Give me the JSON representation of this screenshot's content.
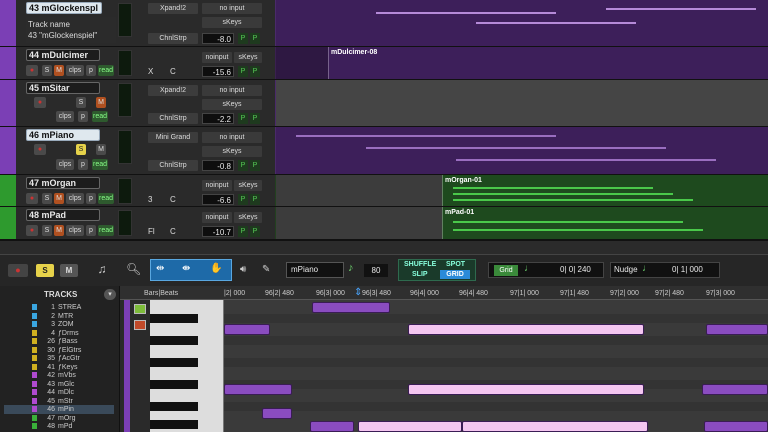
{
  "tracks": [
    {
      "number": "43",
      "name": "mGlockenspl",
      "insert": "Xpand!2",
      "strip": "ChnlStrp",
      "input": "no input",
      "output": "sKeys",
      "volume": "-8.0",
      "color": "#7b3fb5",
      "tooltip_title": "Track name",
      "tooltip_value": "43 \"mGlockenspiel\""
    },
    {
      "number": "44",
      "name": "mDulcimer",
      "insert": "",
      "strip": "",
      "input": "noinput",
      "output": "sKeys",
      "volume": "-15.6",
      "color": "#7b3fb5",
      "clip": "mDulcimer-08",
      "x_label": "X",
      "c_label": "C"
    },
    {
      "number": "45",
      "name": "mSitar",
      "insert": "Xpand!2",
      "strip": "ChnlStrp",
      "input": "no input",
      "output": "sKeys",
      "volume": "-2.2",
      "color": "#7b3fb5"
    },
    {
      "number": "46",
      "name": "mPiano",
      "insert": "Mini Grand",
      "strip": "ChnlStrp",
      "input": "no input",
      "output": "sKeys",
      "volume": "-0.8",
      "color": "#7b3fb5"
    },
    {
      "number": "47",
      "name": "mOrgan",
      "insert": "",
      "strip": "",
      "input": "noinput",
      "output": "sKeys",
      "volume": "-6.6",
      "color": "#2e9a2e",
      "clip": "mOrgan-01",
      "x_label": "3",
      "c_label": "C"
    },
    {
      "number": "48",
      "name": "mPad",
      "insert": "",
      "strip": "",
      "input": "noinput",
      "output": "sKeys",
      "volume": "-10.7",
      "color": "#2e9a2e",
      "clip": "mPad-01",
      "x_label": "Fl",
      "c_label": "C"
    }
  ],
  "track_buttons": {
    "mute": "M",
    "solo": "S",
    "clips": "clps",
    "playlist": "p",
    "read": "read",
    "p": "P"
  },
  "editor_toolbar": {
    "solo": "S",
    "mute": "M",
    "track_select": "mPiano",
    "grid_value_label": "80",
    "shuffle": "SHUFFLE",
    "spot": "SPOT",
    "slip": "SLIP",
    "grid": "GRID",
    "grid_label": "Grid",
    "grid_value": "0| 0| 240",
    "nudge_label": "Nudge",
    "nudge_value": "0| 1| 000"
  },
  "tracks_list": {
    "title": "TRACKS",
    "items": [
      {
        "num": "1",
        "name": "STREA",
        "color": "#3aa6e0"
      },
      {
        "num": "2",
        "name": "MTR",
        "color": "#3aa6e0"
      },
      {
        "num": "3",
        "name": "ZOM",
        "color": "#3aa6e0"
      },
      {
        "num": "4",
        "name": "ƒDrms",
        "color": "#d0b020"
      },
      {
        "num": "26",
        "name": "ƒBass",
        "color": "#d0b020"
      },
      {
        "num": "30",
        "name": "ƒElGtrs",
        "color": "#d0b020"
      },
      {
        "num": "35",
        "name": "ƒAcGtr",
        "color": "#d0b020"
      },
      {
        "num": "41",
        "name": "ƒKeys",
        "color": "#d0b020"
      },
      {
        "num": "42",
        "name": "mVbs",
        "color": "#b04ad0"
      },
      {
        "num": "43",
        "name": "mGlc",
        "color": "#b04ad0"
      },
      {
        "num": "44",
        "name": "mDlc",
        "color": "#b04ad0"
      },
      {
        "num": "45",
        "name": "mStr",
        "color": "#b04ad0"
      },
      {
        "num": "46",
        "name": "mPin",
        "color": "#b04ad0"
      },
      {
        "num": "47",
        "name": "mOrg",
        "color": "#3ab03a"
      },
      {
        "num": "48",
        "name": "mPd",
        "color": "#3ab03a"
      }
    ]
  },
  "ruler": {
    "label": "Bars|Beats",
    "ticks": [
      "|2| 000",
      "96|2| 480",
      "96|3| 000",
      "96|3| 480",
      "96|4| 000",
      "96|4| 480",
      "97|1| 000",
      "97|1| 480",
      "97|2| 000",
      "97|2| 480",
      "97|3| 000"
    ]
  },
  "colors": {
    "purple_track": "#5a2d8a",
    "green_track": "#1e5e1e",
    "midi_note": "#f4c6f0",
    "midi_note_dim": "#8a4cc0",
    "selected_row": "#3a4a5a"
  }
}
